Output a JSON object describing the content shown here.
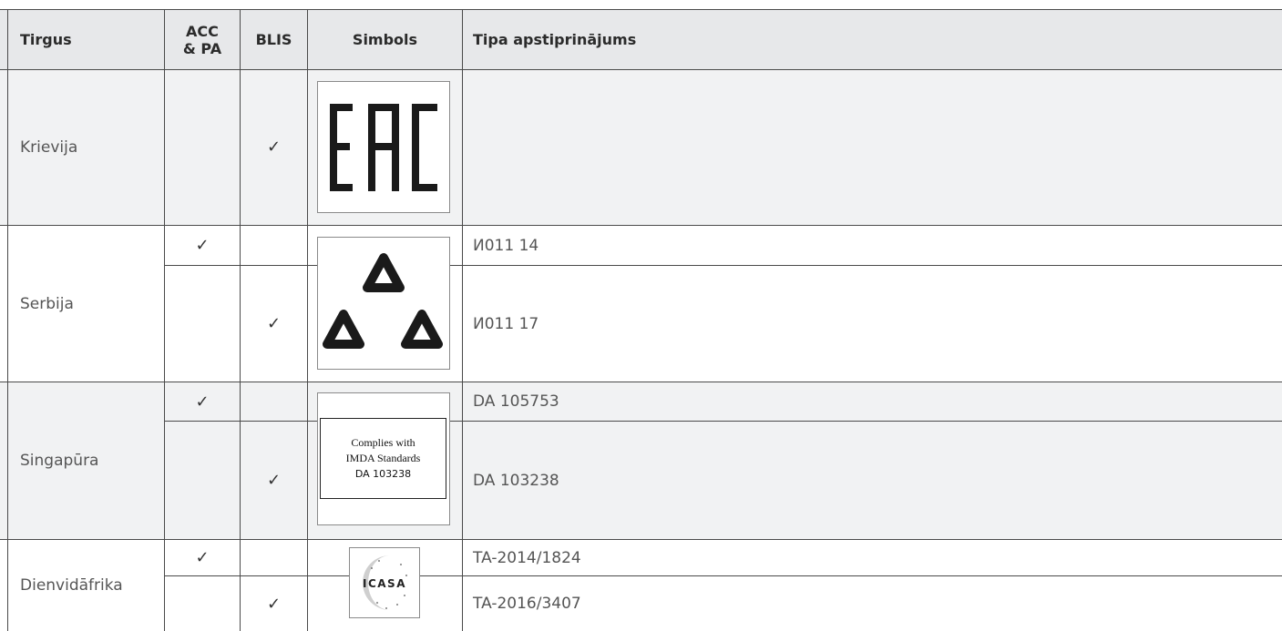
{
  "header": {
    "market": "Tirgus",
    "acc_pa": "ACC\n& PA",
    "blis": "BLIS",
    "symbol": "Simbols",
    "type_approval": "Tipa apstiprinājums"
  },
  "check_mark": "✓",
  "rows": {
    "russia": {
      "market": "Krievija",
      "logo_text": "EAC"
    },
    "serbia": {
      "market": "Serbija",
      "approval_acc": "И011 14",
      "approval_blis": "И011 17"
    },
    "singapore": {
      "market": "Singapūra",
      "approval_acc": "DA 105753",
      "approval_blis": "DA 103238",
      "logo_line1": "Complies with",
      "logo_line2": "IMDA Standards",
      "logo_line3": "DA 103238"
    },
    "south_africa": {
      "market": "Dienvidāfrika",
      "approval_acc": "TA-2014/1824",
      "approval_blis": "TA-2016/3407",
      "logo_text": "ICASA"
    }
  },
  "colors": {
    "header_bg": "#e7e8ea",
    "shaded_bg": "#f1f2f3",
    "line": "#4a4a4a"
  }
}
